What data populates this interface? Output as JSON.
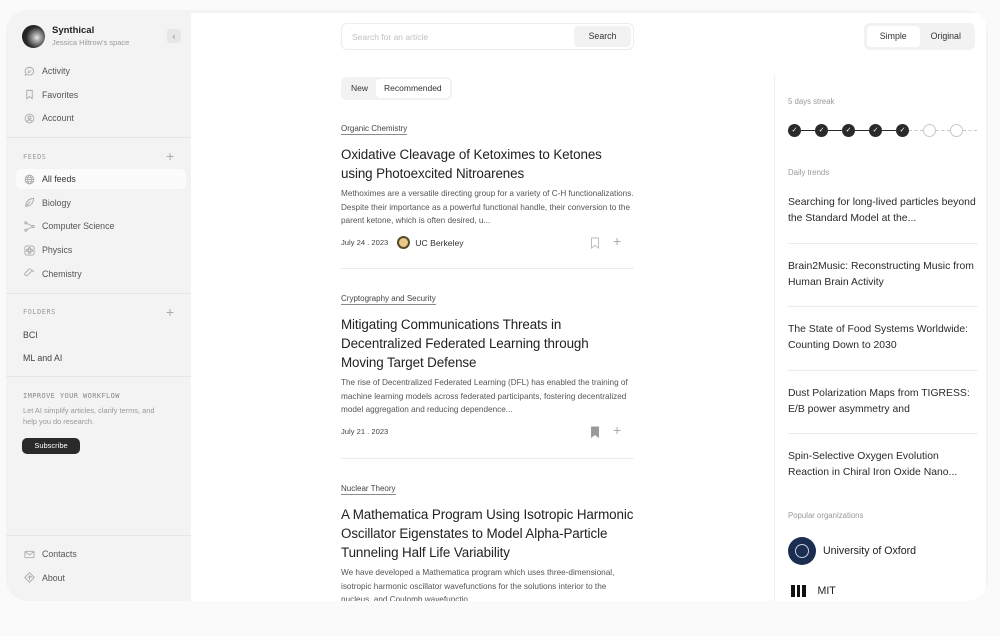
{
  "sidebar": {
    "brand": {
      "name": "Synthical",
      "space": "Jessica Hiltrow's space"
    },
    "collapse_icon": "chevron-left-icon",
    "top_nav": [
      {
        "label": "Activity",
        "icon": "chat-bubble-icon"
      },
      {
        "label": "Favorites",
        "icon": "bookmark-icon"
      },
      {
        "label": "Account",
        "icon": "user-circle-icon"
      }
    ],
    "feeds": {
      "label": "FEEDS",
      "items": [
        {
          "label": "All feeds",
          "icon": "globe-icon",
          "active": true
        },
        {
          "label": "Biology",
          "icon": "leaf-icon"
        },
        {
          "label": "Computer Science",
          "icon": "nodes-icon"
        },
        {
          "label": "Physics",
          "icon": "atom-icon"
        },
        {
          "label": "Chemistry",
          "icon": "test-tube-icon"
        }
      ]
    },
    "folders": {
      "label": "FOLDERS",
      "items": [
        {
          "label": "BCI"
        },
        {
          "label": "ML and AI"
        }
      ]
    },
    "promo": {
      "title": "IMPROVE YOUR WORKFLOW",
      "text": "Let AI simplify articles, clarify terms, and help you do research.",
      "button": "Subscribe"
    },
    "bottom_nav": [
      {
        "label": "Contacts",
        "icon": "mail-icon"
      },
      {
        "label": "About",
        "icon": "signpost-icon"
      }
    ]
  },
  "header": {
    "search": {
      "placeholder": "Search for an article",
      "value": "",
      "button": "Search"
    },
    "view_toggle": {
      "options": [
        "Simple",
        "Original"
      ],
      "selected": "Simple"
    }
  },
  "feed": {
    "tabs": [
      {
        "label": "New"
      },
      {
        "label": "Recommended",
        "active": true
      }
    ],
    "articles": [
      {
        "category": "Organic Chemistry",
        "title": "Oxidative Cleavage of Ketoximes to Ketones using Photoexcited Nitroarenes",
        "excerpt": "Methoximes are a versatile directing group for a variety of C-H functionalizations. Despite their importance as a powerful functional handle, their conversion to the parent ketone, which is often desired, u...",
        "date": "July 24 . 2023",
        "org": "UC Berkeley",
        "bookmarked": false
      },
      {
        "category": "Cryptography and Security",
        "title": "Mitigating Communications Threats in Decentralized Federated Learning through Moving Target Defense",
        "excerpt": "The rise of Decentralized Federated Learning (DFL) has enabled the training of machine learning models across federated participants, fostering decentralized model aggregation and reducing dependence...",
        "date": "July 21 . 2023",
        "org": "",
        "bookmarked": true
      },
      {
        "category": "Nuclear Theory",
        "title": "A Mathematica Program Using Isotropic Harmonic Oscillator Eigenstates to Model Alpha-Particle Tunneling Half Life Variability",
        "excerpt": "We have developed a Mathematica program which uses three-dimensional, isotropic harmonic oscillator wavefunctions for the solutions interior to the nucleus, and Coulomb wavefunctio...",
        "date": "",
        "org": "",
        "bookmarked": false
      }
    ]
  },
  "right_panel": {
    "streak": {
      "label": "5 days streak",
      "completed_days": 5,
      "total_days": 7
    },
    "trends_label": "Daily trends",
    "trends": [
      "Searching for long-lived particles beyond the Standard Model at the...",
      "Brain2Music: Reconstructing Music from Human Brain Activity",
      "The State of Food Systems Worldwide: Counting Down to 2030",
      "Dust Polarization Maps from TIGRESS: E/B power asymmetry and",
      "Spin-Selective Oxygen Evolution Reaction in Chiral Iron Oxide Nano..."
    ],
    "orgs_label": "Popular organizations",
    "orgs": [
      {
        "name": "University of Oxford",
        "logo": "oxford-crest-icon",
        "color": "#1c2d52"
      },
      {
        "name": "MIT",
        "logo": "mit-logo-icon",
        "color": "#111111"
      }
    ]
  }
}
